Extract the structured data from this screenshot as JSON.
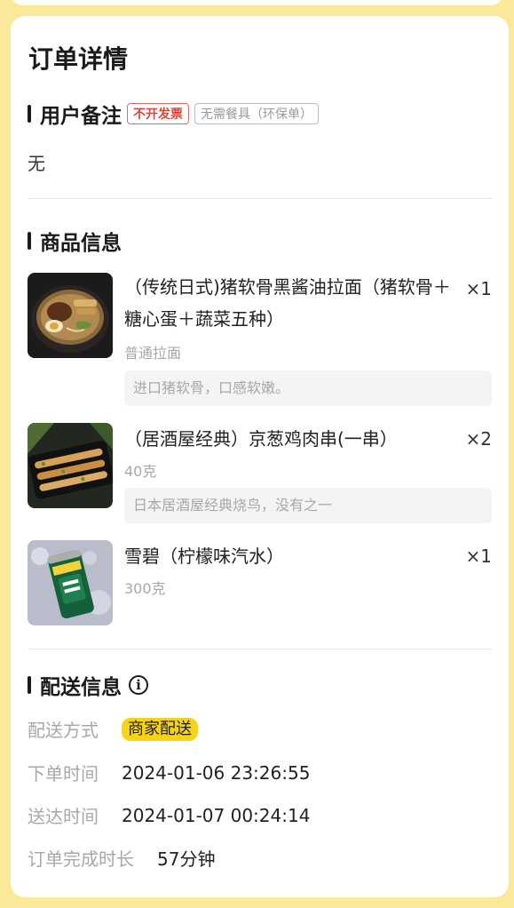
{
  "page_title": "订单详情",
  "remark": {
    "title": "用户备注",
    "tags": [
      "不开发票",
      "无需餐具（环保单）"
    ],
    "content": "无"
  },
  "goods": {
    "title": "商品信息",
    "items": [
      {
        "name": "（传统日式)猪软骨黑酱油拉面（猪软骨＋糖心蛋＋蔬菜五种）",
        "qty": "×1",
        "spec": "普通拉面",
        "note": "进口猪软骨，口感软嫩。",
        "image": "ramen-bowl-image"
      },
      {
        "name": "（居酒屋经典）京葱鸡肉串(一串）",
        "qty": "×2",
        "spec": "40克",
        "note": "日本居酒屋经典烧鸟，没有之一",
        "image": "chicken-skewer-image"
      },
      {
        "name": "雪碧（柠檬味汽水）",
        "qty": "×1",
        "spec": "300克",
        "note": "",
        "image": "sprite-can-image"
      }
    ]
  },
  "delivery": {
    "title": "配送信息",
    "icon": "info-icon",
    "rows": [
      {
        "label": "配送方式",
        "value": "商家配送"
      },
      {
        "label": "下单时间",
        "value": "2024-01-06 23:26:55"
      },
      {
        "label": "送达时间",
        "value": "2024-01-07 00:24:14"
      },
      {
        "label": "订单完成时长",
        "value": "57分钟"
      }
    ]
  },
  "colors": {
    "background": "#fbe99a",
    "accent_yellow": "#f7d313",
    "tag_red": "#d9453a"
  }
}
